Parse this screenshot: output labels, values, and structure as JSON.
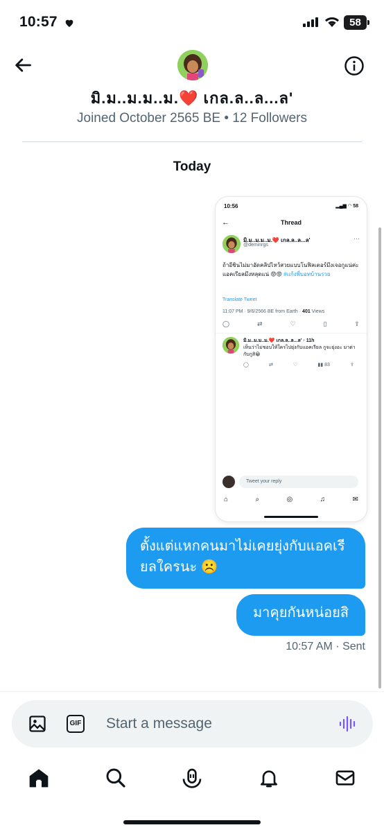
{
  "status_bar": {
    "time": "10:57",
    "battery": "58"
  },
  "header": {
    "name": "มิ.ม..ม.ม..ม.❤️ เกล.ล..ล...ล'",
    "meta": "Joined October 2565 BE • 12 Followers"
  },
  "date_separator": "Today",
  "shared_screenshot": {
    "time": "10:56",
    "battery": "58",
    "title": "Thread",
    "author_name": "มิ.ม..ม.ม..ม.❤️ เกล.ล..ล...ล'",
    "author_handle": "@deminrgs",
    "tweet_text": "ถ้าอีชินไม่มาอัดคลิปไหว้สวยแบบโนฟิลเตอร์มึงเจอกูแน่ค่ะ แอคเรียลมึงหลุดแน่ 😡😡",
    "hashtag": "#แก้งพี่บอทบ้านรวย",
    "translate": "Translate Tweet",
    "info_prefix": "11:07 PM · 9/6/2566 BE from Earth · ",
    "views_count": "401",
    "views_label": " Views",
    "reply_name": "มิ.ม..ม.ม..ม.❤️ เกล.ล..ล...ล' · 11h",
    "reply_text": "เห็นว่าไม่ชอบให้ใครไปยุ่งกับแอคเรียล กูจะยุ่งอะ มาด่ากับกูสิ😀",
    "reply_views": "83",
    "reply_placeholder": "Tweet your reply"
  },
  "messages": [
    {
      "text": "ตั้งแต่แหกคนมาไม่เคยยุ่งกับแอคเรียลใครนะ ☹️"
    },
    {
      "text": "มาคุยกันหน่อยสิ"
    }
  ],
  "message_meta": "10:57 AM · Sent",
  "composer": {
    "placeholder": "Start a message",
    "gif_label": "GIF"
  },
  "colors": {
    "accent": "#1d9bf0",
    "voice": "#7856ff"
  }
}
